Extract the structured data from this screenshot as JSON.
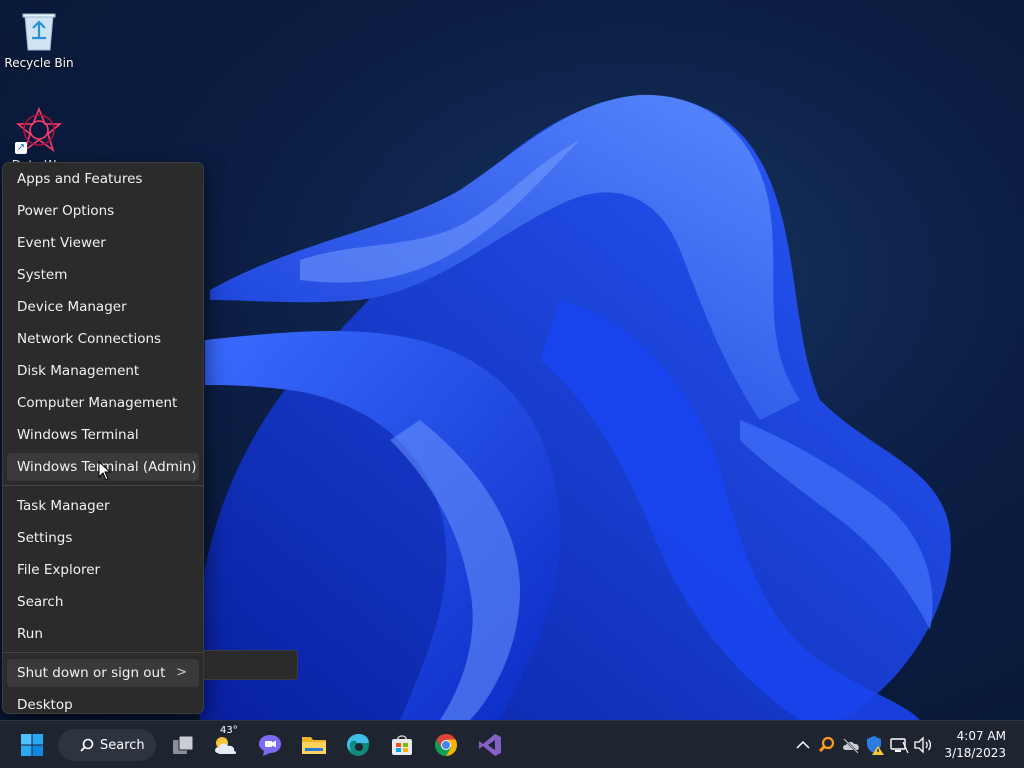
{
  "desktop": {
    "icons": [
      {
        "label": "Recycle Bin",
        "icon": "recycle-bin-icon"
      },
      {
        "label": "Data W...",
        "icon": "data-shortcut-icon"
      }
    ]
  },
  "context_menu": {
    "group1": [
      {
        "label": "Apps and Features"
      },
      {
        "label": "Power Options"
      },
      {
        "label": "Event Viewer"
      },
      {
        "label": "System"
      },
      {
        "label": "Device Manager"
      },
      {
        "label": "Network Connections"
      },
      {
        "label": "Disk Management"
      },
      {
        "label": "Computer Management"
      },
      {
        "label": "Windows Terminal"
      },
      {
        "label": "Windows Terminal (Admin)",
        "hovered": true
      }
    ],
    "group2": [
      {
        "label": "Task Manager"
      },
      {
        "label": "Settings"
      },
      {
        "label": "File Explorer"
      },
      {
        "label": "Search"
      },
      {
        "label": "Run"
      }
    ],
    "group3": [
      {
        "label": "Shut down or sign out",
        "submenu_glyph": ">"
      },
      {
        "label": "Desktop"
      }
    ]
  },
  "taskbar": {
    "start_icon": "windows-start-icon",
    "search_label": "Search",
    "weather_temp": "43°",
    "pinned": [
      "task-view-icon",
      "weather-icon",
      "chat-icon",
      "file-explorer-icon",
      "edge-icon",
      "store-icon",
      "chrome-icon",
      "visual-studio-icon"
    ],
    "tray": [
      "chevron-up-icon",
      "search-tool-icon",
      "cloud-offline-icon",
      "security-shield-icon",
      "network-icon",
      "volume-icon"
    ]
  },
  "clock": {
    "time": "4:07 AM",
    "date": "3/18/2023"
  },
  "colors": {
    "menu_bg": "#2b2b2b",
    "menu_hover": "#3a3a3a",
    "taskbar_bg": "#1e2530",
    "wallpaper_accent": "#1d4fff"
  }
}
